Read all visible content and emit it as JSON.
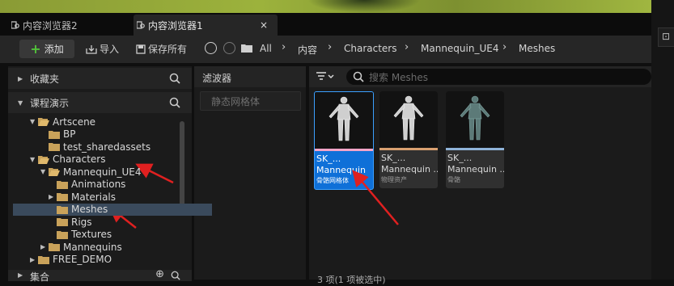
{
  "tabs": [
    {
      "label": "内容浏览器2",
      "active": false
    },
    {
      "label": "内容浏览器1",
      "active": true,
      "close": "×"
    }
  ],
  "toolbar": {
    "add_label": "添加",
    "import_label": "导入",
    "save_all_label": "保存所有"
  },
  "breadcrumb": [
    "All",
    "内容",
    "Characters",
    "Mannequin_UE4",
    "Meshes"
  ],
  "left": {
    "favorites_label": "收藏夹",
    "project_label": "课程演示",
    "collections_label": "集合",
    "tree": [
      {
        "label": "Artscene",
        "level": 1,
        "expanded": true
      },
      {
        "label": "BP",
        "level": 2
      },
      {
        "label": "test_sharedassets",
        "level": 2
      },
      {
        "label": "Characters",
        "level": 1,
        "expanded": true
      },
      {
        "label": "Mannequin_UE4",
        "level": 2,
        "expanded": true
      },
      {
        "label": "Animations",
        "level": 3
      },
      {
        "label": "Materials",
        "level": 3,
        "collapsed": true
      },
      {
        "label": "Meshes",
        "level": 3,
        "selected": true
      },
      {
        "label": "Rigs",
        "level": 3
      },
      {
        "label": "Textures",
        "level": 3
      },
      {
        "label": "Mannequins",
        "level": 2,
        "collapsed": true
      },
      {
        "label": "FREE_DEMO",
        "level": 1,
        "collapsed": true
      }
    ]
  },
  "filters": {
    "header": "滤波器",
    "chip": "静态网格体"
  },
  "search": {
    "placeholder": "搜索 Meshes"
  },
  "assets": [
    {
      "name1": "SK_...",
      "name2": "Mannequin",
      "type": "骨骼网格体",
      "bar_color": "#f3a5c8",
      "selected": true
    },
    {
      "name1": "SK_...",
      "name2": "Mannequin ...",
      "type": "物理资产",
      "bar_color": "#d9a070",
      "selected": false
    },
    {
      "name1": "SK_...",
      "name2": "Mannequin ...",
      "type": "骨骼",
      "bar_color": "#8fb3d8",
      "selected": false
    }
  ],
  "status": "3 项(1 项被选中)",
  "colors": {
    "accent": "#0f70d8",
    "folder": "#c9a25a",
    "add_plus": "#52c23a",
    "annotation_arrow": "#e02020"
  }
}
